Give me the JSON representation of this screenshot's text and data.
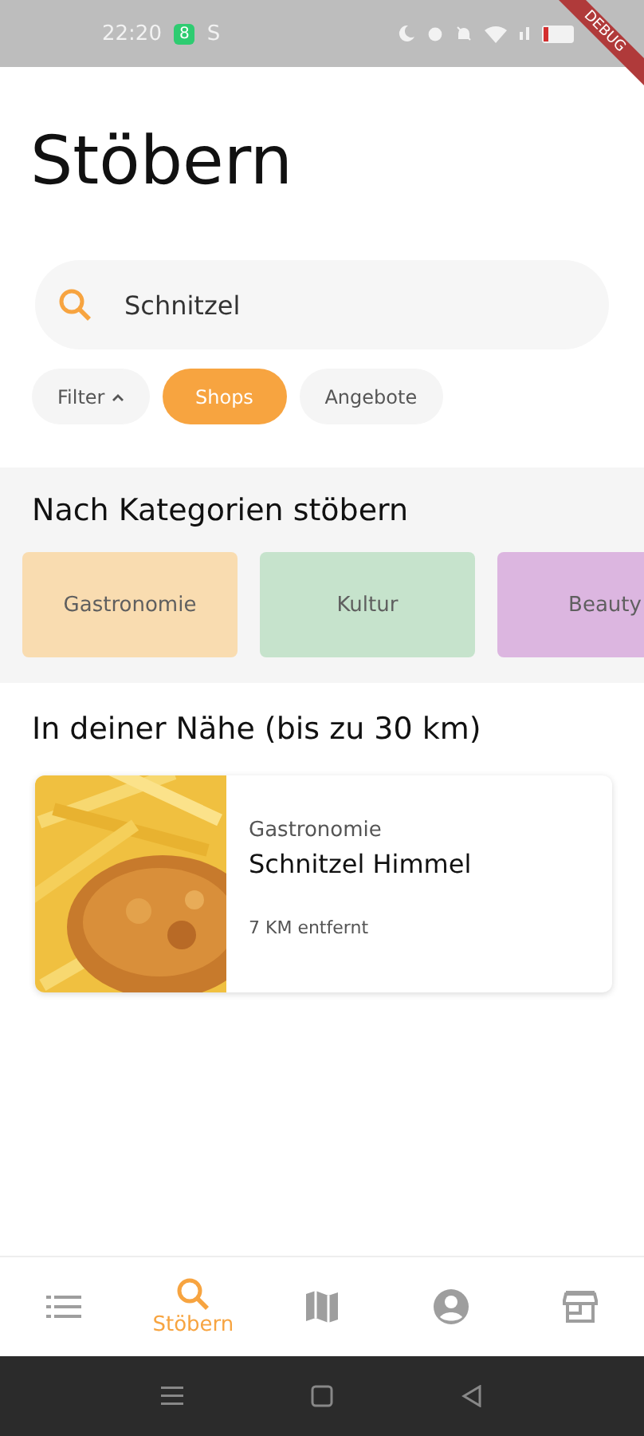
{
  "status_bar": {
    "time": "22:20",
    "badge": "8",
    "carrier": "S",
    "debug": "DEBUG"
  },
  "title": "Stöbern",
  "search": {
    "value": "Schnitzel"
  },
  "chips": [
    {
      "label": "Filter",
      "kind": "dropdown",
      "selected": false
    },
    {
      "label": "Shops",
      "kind": "plain",
      "selected": true
    },
    {
      "label": "Angebote",
      "kind": "plain",
      "selected": false
    }
  ],
  "categories": {
    "heading": "Nach Kategorien stöbern",
    "items": [
      {
        "label": "Gastronomie",
        "color": "#f9dcb0"
      },
      {
        "label": "Kultur",
        "color": "#c6e3cc"
      },
      {
        "label": "Beauty",
        "color": "#dcb6e0"
      }
    ]
  },
  "nearby": {
    "heading": "In deiner Nähe (bis zu 30 km)",
    "results": [
      {
        "category": "Gastronomie",
        "name": "Schnitzel Himmel",
        "distance": "7 KM entfernt",
        "kind": "picture"
      }
    ]
  },
  "bottom_nav": [
    {
      "kind": "list",
      "selected": false
    },
    {
      "kind": "search",
      "label": "Stöbern",
      "selected": true
    },
    {
      "kind": "map",
      "selected": false
    },
    {
      "kind": "account",
      "selected": false
    },
    {
      "kind": "store",
      "selected": false
    }
  ]
}
